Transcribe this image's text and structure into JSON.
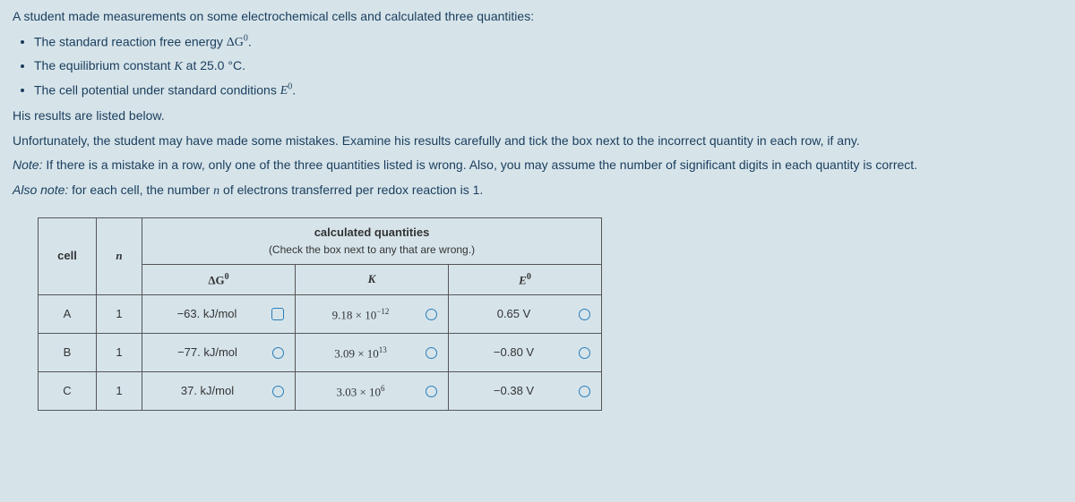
{
  "intro": "A student made measurements on some electrochemical cells and calculated three quantities:",
  "bullets": {
    "b1_pre": "The standard reaction free energy ",
    "b1_sym": "ΔG",
    "b1_sup": "0",
    "b1_post": ".",
    "b2_pre": "The equilibrium constant ",
    "b2_sym": "K",
    "b2_post": " at 25.0 °C.",
    "b3_pre": "The cell potential under standard conditions ",
    "b3_sym": "E",
    "b3_sup": "0",
    "b3_post": "."
  },
  "p_results": "His results are listed below.",
  "p_unfortunate": "Unfortunately, the student may have made some mistakes. Examine his results carefully and tick the box next to the incorrect quantity in each row, if any.",
  "p_note_label": "Note:",
  "p_note_body": " If there is a mistake in a row, only one of the three quantities listed is wrong. Also, you may assume the number of significant digits in each quantity is correct.",
  "p_also_label": "Also note:",
  "p_also_pre": " for each cell, the number ",
  "p_also_n": "n",
  "p_also_post": " of electrons transferred per redox reaction is 1.",
  "table": {
    "header_cell": "cell",
    "header_n": "n",
    "header_calc_title": "calculated quantities",
    "header_calc_sub": "(Check the box next to any that are wrong.)",
    "col_dg": "ΔG",
    "col_dg_sup": "0",
    "col_k": "K",
    "col_e": "E",
    "col_e_sup": "0",
    "rows": [
      {
        "cell": "A",
        "n": "1",
        "dg": "−63. kJ/mol",
        "k_base": "9.18 × 10",
        "k_exp": "−12",
        "e": "0.65 V"
      },
      {
        "cell": "B",
        "n": "1",
        "dg": "−77. kJ/mol",
        "k_base": "3.09 × 10",
        "k_exp": "13",
        "e": "−0.80 V"
      },
      {
        "cell": "C",
        "n": "1",
        "dg": "37. kJ/mol",
        "k_base": "3.03 × 10",
        "k_exp": "6",
        "e": "−0.38 V"
      }
    ]
  }
}
